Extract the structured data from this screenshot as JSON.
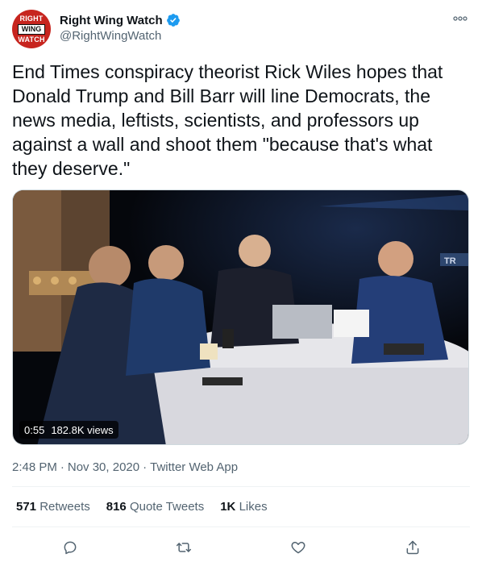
{
  "author": {
    "avatar_lines": [
      "RIGHT",
      "WING",
      "WATCH"
    ],
    "display_name": "Right Wing Watch",
    "handle": "@RightWingWatch",
    "verified": true
  },
  "tweet": {
    "text": "End Times conspiracy theorist Rick Wiles hopes that Donald Trump and Bill Barr will line Democrats, the news media, leftists, scientists, and professors up against a wall and shoot them \"because that's what they deserve.\""
  },
  "media": {
    "type": "video",
    "duration": "0:55",
    "views": "182.8K views",
    "corner_text": "TR"
  },
  "meta": {
    "time": "2:48 PM",
    "date": "Nov 30, 2020",
    "source": "Twitter Web App",
    "separator": "·"
  },
  "stats": {
    "retweets_count": "571",
    "retweets_label": "Retweets",
    "quotes_count": "816",
    "quotes_label": "Quote Tweets",
    "likes_count": "1K",
    "likes_label": "Likes"
  },
  "icons": {
    "more": "more-icon",
    "reply": "reply-icon",
    "retweet": "retweet-icon",
    "like": "heart-icon",
    "share": "share-icon",
    "verified": "verified-badge-icon"
  },
  "colors": {
    "verified_blue": "#1d9bf0",
    "secondary_text": "#536471",
    "brand_red": "#c7251f"
  }
}
